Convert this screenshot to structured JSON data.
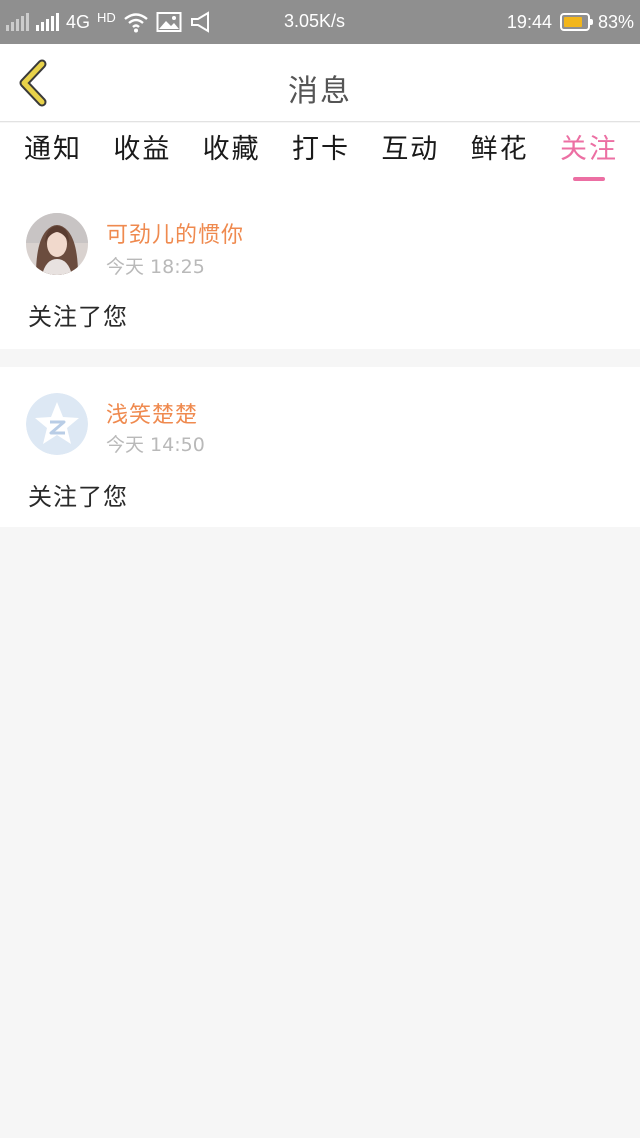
{
  "status_bar": {
    "network_type": "4G",
    "hd_label": "HD",
    "speed": "3.05K/s",
    "time": "19:44",
    "battery_percent": "83%",
    "battery_level": 0.83,
    "battery_color": "#f2b61b"
  },
  "header": {
    "title": "消息",
    "back_icon": "chevron-left-icon",
    "back_icon_color": "#e8d24a"
  },
  "tabs": [
    {
      "label": "通知"
    },
    {
      "label": "收益"
    },
    {
      "label": "收藏"
    },
    {
      "label": "打卡"
    },
    {
      "label": "互动"
    },
    {
      "label": "鲜花"
    },
    {
      "label": "关注",
      "active": true
    }
  ],
  "accent_color": "#ec6fa3",
  "messages": [
    {
      "user": "可劲儿的惯你",
      "time": "今天 18:25",
      "text": "关注了您",
      "avatar": "photo-avatar"
    },
    {
      "user": "浅笑楚楚",
      "time": "今天 14:50",
      "text": "关注了您",
      "avatar": "default-qzone-avatar"
    }
  ]
}
